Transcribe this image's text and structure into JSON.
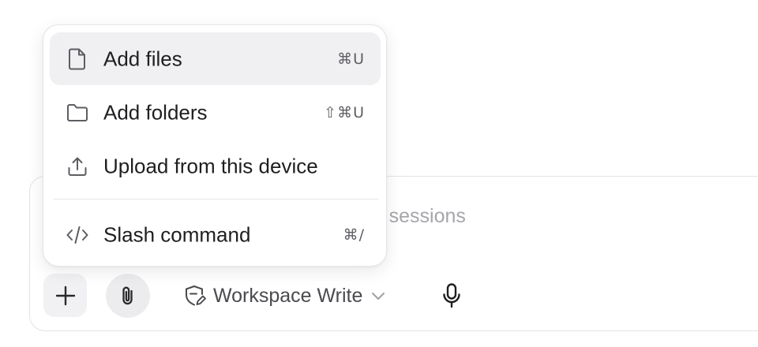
{
  "composer": {
    "placeholder": "Ask, / for commands, @ files or sessions",
    "mode_label": "Workspace Write",
    "icons": {
      "plus": "plus-icon",
      "attach": "paperclip-icon",
      "mode": "shield-edit-icon",
      "dropdown": "chevron-down-icon",
      "mic": "microphone-icon"
    }
  },
  "menu": {
    "items": [
      {
        "label": "Add files",
        "shortcut": "⌘U",
        "icon": "file-icon",
        "active": true
      },
      {
        "label": "Add folders",
        "shortcut": "⇧⌘U",
        "icon": "folder-icon",
        "active": false
      },
      {
        "label": "Upload from this device",
        "shortcut": "",
        "icon": "upload-icon",
        "active": false
      },
      {
        "label": "Slash command",
        "shortcut": "⌘/",
        "icon": "code-icon",
        "active": false
      }
    ]
  },
  "colors": {
    "menu_hover": "#f0f0f2",
    "border": "#e3e3e6",
    "text": "#1f1f22",
    "muted": "#5d5d63",
    "placeholder": "#a6a6ab"
  }
}
